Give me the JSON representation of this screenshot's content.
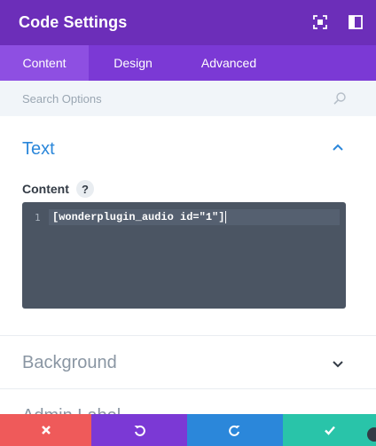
{
  "header": {
    "title": "Code Settings",
    "icons": [
      "fullscreen-icon",
      "sidebar-toggle-icon"
    ]
  },
  "tabs": [
    {
      "label": "Content",
      "active": true
    },
    {
      "label": "Design",
      "active": false
    },
    {
      "label": "Advanced",
      "active": false
    }
  ],
  "search": {
    "placeholder": "Search Options",
    "value": ""
  },
  "sections": {
    "text": {
      "title": "Text",
      "expanded": true,
      "field_label": "Content",
      "help": "?",
      "editor": {
        "line_number": "1",
        "code": "[wonderplugin_audio id=\"1\"]"
      }
    },
    "background": {
      "title": "Background",
      "expanded": false
    },
    "admin_label": {
      "title": "Admin Label",
      "expanded": false
    }
  },
  "footer": {
    "buttons": [
      "close-icon",
      "undo-icon",
      "redo-icon",
      "check-icon"
    ]
  },
  "colors": {
    "header": "#6c2eb9",
    "tabs": "#7b39d5",
    "active_tab": "#8e4fe2",
    "accent_blue": "#2b87da",
    "cancel": "#ef5a5a",
    "save": "#29c4a9",
    "editor_bg": "#4b5563"
  }
}
